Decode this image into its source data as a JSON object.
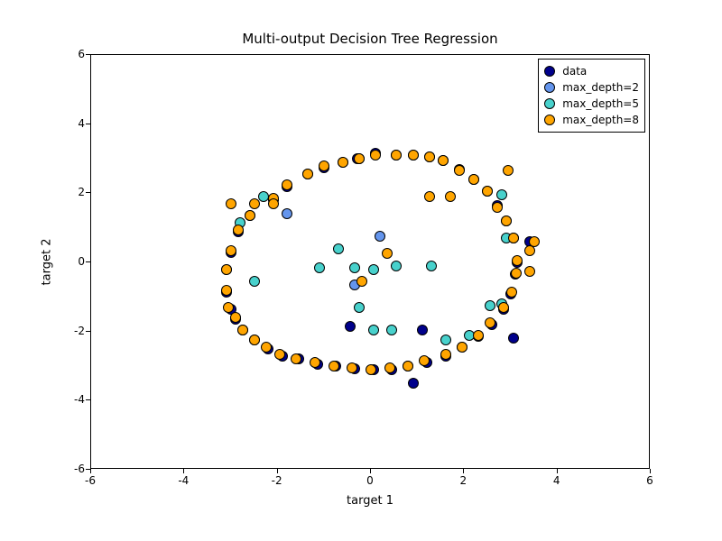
{
  "chart_data": {
    "type": "scatter",
    "title": "Multi-output Decision Tree Regression",
    "xlabel": "target 1",
    "ylabel": "target 2",
    "xlim": [
      -6,
      6
    ],
    "ylim": [
      -6,
      6
    ],
    "xticks": [
      -6,
      -4,
      -2,
      0,
      2,
      4,
      6
    ],
    "yticks": [
      -6,
      -4,
      -2,
      0,
      2,
      4,
      6
    ],
    "legend": {
      "position": "upper right",
      "entries": [
        "data",
        "max_depth=2",
        "max_depth=5",
        "max_depth=8"
      ]
    },
    "colors": {
      "data": "#00008b",
      "max_depth=2": "#6495ed",
      "max_depth=5": "#48d1cc",
      "max_depth=8": "#ffa500"
    },
    "series": [
      {
        "name": "data",
        "x": [
          3.14,
          3.05,
          2.9,
          2.7,
          2.5,
          2.2,
          1.9,
          1.55,
          1.25,
          0.9,
          0.55,
          0.1,
          -0.25,
          -0.6,
          -1.0,
          -1.35,
          -1.8,
          -2.1,
          -2.6,
          -2.85,
          -3.0,
          -3.1,
          -3.1,
          -3.0,
          -2.9,
          -2.75,
          -2.5,
          -2.2,
          -1.9,
          -1.55,
          -1.15,
          -0.75,
          -0.35,
          0.05,
          0.45,
          0.8,
          1.2,
          1.6,
          1.95,
          2.3,
          2.6,
          2.85,
          3.0,
          3.1,
          0.9,
          -0.3,
          1.1,
          3.4,
          -0.45,
          3.05
        ],
        "y": [
          0.0,
          0.7,
          1.2,
          1.65,
          2.05,
          2.4,
          2.7,
          2.95,
          3.05,
          3.1,
          3.1,
          3.15,
          3.0,
          2.9,
          2.75,
          2.55,
          2.2,
          1.8,
          1.35,
          0.9,
          0.3,
          -0.2,
          -0.85,
          -1.35,
          -1.65,
          -1.95,
          -2.25,
          -2.5,
          -2.7,
          -2.8,
          -2.95,
          -3.0,
          -3.08,
          -3.1,
          -3.1,
          -3.0,
          -2.9,
          -2.7,
          -2.45,
          -2.15,
          -1.8,
          -1.35,
          -0.9,
          -0.35,
          -3.5,
          3.0,
          -1.95,
          0.6,
          -1.85,
          -2.2
        ]
      },
      {
        "name": "max_depth=2",
        "x": [
          0.2,
          -0.35,
          -1.8
        ],
        "y": [
          0.75,
          -0.65,
          1.4
        ]
      },
      {
        "name": "max_depth=5",
        "x": [
          -2.5,
          -1.1,
          -0.35,
          0.05,
          0.55,
          1.3,
          0.45,
          -0.25,
          0.05,
          -0.7,
          2.8,
          2.55,
          2.1,
          1.6,
          2.9,
          -2.3,
          -2.8,
          2.8
        ],
        "y": [
          -0.55,
          -0.15,
          -0.15,
          -0.2,
          -0.1,
          -0.1,
          -1.95,
          -1.3,
          -1.95,
          0.4,
          -1.2,
          -1.25,
          -2.1,
          -2.25,
          0.7,
          1.9,
          1.15,
          1.95
        ]
      },
      {
        "name": "max_depth=8",
        "x": [
          3.14,
          3.05,
          2.9,
          2.7,
          2.5,
          2.2,
          1.9,
          1.55,
          1.25,
          0.9,
          0.55,
          0.1,
          -0.25,
          -0.6,
          -1.0,
          -1.35,
          -1.8,
          -2.1,
          -2.6,
          -2.85,
          -3.0,
          -3.1,
          -3.1,
          -3.05,
          -2.9,
          -2.75,
          -2.5,
          -2.25,
          -1.95,
          -1.6,
          -1.2,
          -0.8,
          -0.4,
          0.0,
          0.4,
          0.8,
          1.15,
          1.6,
          1.95,
          2.3,
          2.55,
          2.85,
          3.02,
          3.12,
          -3.0,
          -2.5,
          1.25,
          1.7,
          3.4,
          -2.1,
          0.35,
          -0.2,
          2.95,
          3.4,
          3.5
        ],
        "y": [
          0.05,
          0.7,
          1.2,
          1.6,
          2.05,
          2.4,
          2.65,
          2.95,
          3.05,
          3.1,
          3.1,
          3.1,
          3.0,
          2.9,
          2.8,
          2.55,
          2.25,
          1.85,
          1.35,
          0.95,
          0.35,
          -0.2,
          -0.8,
          -1.3,
          -1.6,
          -1.95,
          -2.25,
          -2.45,
          -2.65,
          -2.8,
          -2.9,
          -3.0,
          -3.05,
          -3.1,
          -3.05,
          -3.0,
          -2.85,
          -2.65,
          -2.45,
          -2.1,
          -1.75,
          -1.3,
          -0.85,
          -0.3,
          1.7,
          1.7,
          1.9,
          1.9,
          0.35,
          1.7,
          0.25,
          -0.55,
          2.65,
          -0.25,
          0.6
        ]
      }
    ]
  }
}
